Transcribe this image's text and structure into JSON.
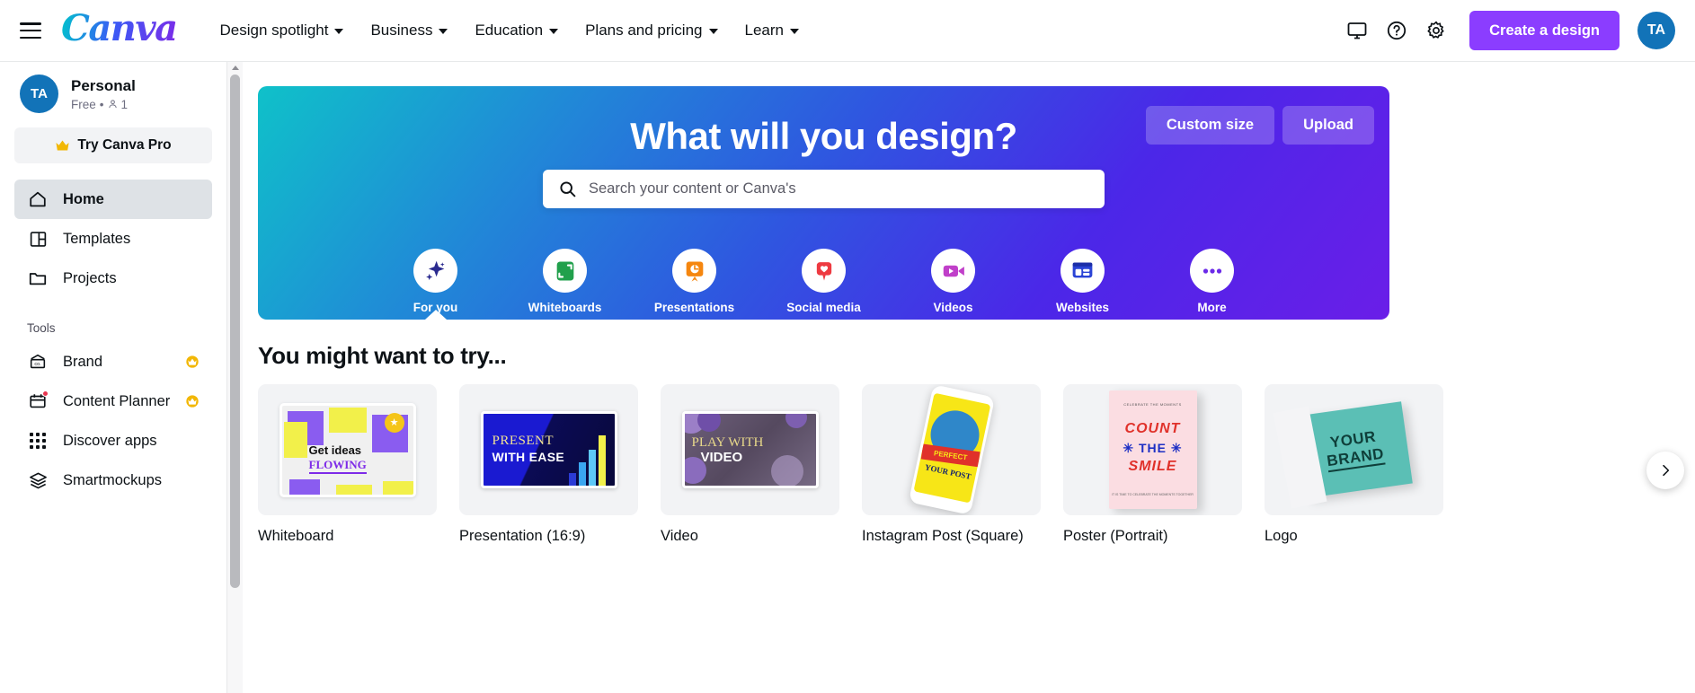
{
  "header": {
    "menu_icon": "hamburger-icon",
    "logo_text": "Canva",
    "nav": [
      {
        "label": "Design spotlight"
      },
      {
        "label": "Business"
      },
      {
        "label": "Education"
      },
      {
        "label": "Plans and pricing"
      },
      {
        "label": "Learn"
      }
    ],
    "icons": [
      {
        "name": "desktop-app-icon"
      },
      {
        "name": "help-icon"
      },
      {
        "name": "settings-gear-icon"
      }
    ],
    "create_button": "Create a design",
    "avatar_initials": "TA"
  },
  "sidebar": {
    "account": {
      "avatar_initials": "TA",
      "name": "Personal",
      "plan": "Free",
      "separator": "•",
      "members": "1"
    },
    "pro_button": {
      "label": "Try Canva Pro",
      "icon": "crown-icon"
    },
    "nav": [
      {
        "label": "Home",
        "icon": "home-icon",
        "active": true
      },
      {
        "label": "Templates",
        "icon": "templates-icon",
        "active": false
      },
      {
        "label": "Projects",
        "icon": "folder-icon",
        "active": false
      }
    ],
    "tools_heading": "Tools",
    "tools": [
      {
        "label": "Brand",
        "icon": "brand-icon",
        "crown": true,
        "dot": false
      },
      {
        "label": "Content Planner",
        "icon": "calendar-icon",
        "crown": true,
        "dot": true
      },
      {
        "label": "Discover apps",
        "icon": "apps-grid-icon",
        "crown": false,
        "dot": false
      },
      {
        "label": "Smartmockups",
        "icon": "layers-icon",
        "crown": false,
        "dot": false
      }
    ]
  },
  "hero": {
    "title": "What will you design?",
    "search_placeholder": "Search your content or Canva's",
    "search_value": "",
    "search_icon": "search-icon",
    "buttons": [
      {
        "label": "Custom size"
      },
      {
        "label": "Upload"
      }
    ],
    "categories": [
      {
        "label": "For you",
        "icon": "sparkle-icon",
        "color": "#2b2b8f",
        "active": true
      },
      {
        "label": "Whiteboards",
        "icon": "whiteboard-icon",
        "color": "#21A04C",
        "active": false
      },
      {
        "label": "Presentations",
        "icon": "presentation-icon",
        "color": "#F5860F",
        "active": false
      },
      {
        "label": "Social media",
        "icon": "heart-pin-icon",
        "color": "#EE3A41",
        "active": false
      },
      {
        "label": "Videos",
        "icon": "video-camera-icon",
        "color": "#C03FC9",
        "active": false
      },
      {
        "label": "Websites",
        "icon": "website-icon",
        "color": "#2b44d6",
        "active": false
      },
      {
        "label": "More",
        "icon": "more-dots-icon",
        "color": "#6b2ae8",
        "active": false
      }
    ],
    "gradient": {
      "from": "#0fc1c9",
      "mid": "#2f56e0",
      "to": "#6a1ee8"
    }
  },
  "try_section": {
    "title": "You might want to try...",
    "next_icon": "chevron-right-icon",
    "cards": [
      {
        "label": "Whiteboard",
        "thumb": "whiteboard-thumb",
        "text1": "Get ideas",
        "text2": "FLOWING"
      },
      {
        "label": "Presentation (16:9)",
        "thumb": "presentation-thumb",
        "text1": "PRESENT",
        "text2": "WITH EASE"
      },
      {
        "label": "Video",
        "thumb": "video-thumb",
        "text1": "PLAY WITH",
        "text2": "VIDEO"
      },
      {
        "label": "Instagram Post (Square)",
        "thumb": "instagram-thumb",
        "text1": "PERFECT",
        "text2": "YOUR POST"
      },
      {
        "label": "Poster (Portrait)",
        "thumb": "poster-thumb",
        "text1": "COUNT",
        "text2": "THE",
        "text3": "SMILE",
        "top": "CELEBRATE THE MOMENTS",
        "bottom": "IT IS TIME TO CELEBRATE THE MOMENTS TOGETHER"
      },
      {
        "label": "Logo",
        "thumb": "logo-thumb",
        "text1": "YOUR",
        "text2": "BRAND"
      }
    ]
  },
  "colors": {
    "brand_purple": "#8b3dff",
    "avatar_blue": "#1273b8",
    "sidebar_active": "#dee2e6",
    "badge_red": "#e8344e",
    "crown_gold": "#f2b705"
  }
}
